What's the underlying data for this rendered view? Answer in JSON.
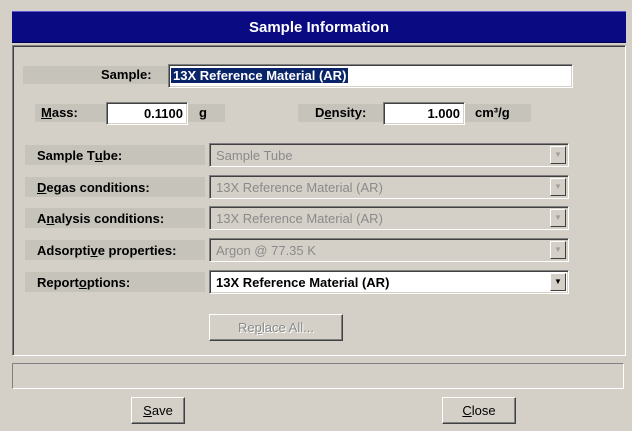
{
  "window": {
    "title": "Sample Information"
  },
  "sample": {
    "label": "Sample:",
    "value": "13X Reference Material (AR)"
  },
  "mass": {
    "label_pre": "",
    "label_key": "M",
    "label_post": "ass:",
    "value": "0.1100",
    "unit": "g"
  },
  "density": {
    "label_pre": "D",
    "label_key": "e",
    "label_post": "nsity:",
    "value": "1.000",
    "unit": "cm³/g"
  },
  "rows": [
    {
      "label_pre": "Sample T",
      "label_key": "u",
      "label_post": "be:",
      "value": "Sample Tube",
      "enabled": false
    },
    {
      "label_pre": "",
      "label_key": "D",
      "label_post": "egas conditions:",
      "value": "13X Reference Material (AR)",
      "enabled": false
    },
    {
      "label_pre": "A",
      "label_key": "n",
      "label_post": "alysis conditions:",
      "value": "13X Reference Material (AR)",
      "enabled": false
    },
    {
      "label_pre": "Adsorpti",
      "label_key": "v",
      "label_post": "e properties:",
      "value": "Argon @ 77.35 K",
      "enabled": false
    },
    {
      "label_pre": "Report ",
      "label_key": "o",
      "label_post": "ptions:",
      "value": "13X Reference Material (AR)",
      "enabled": true
    }
  ],
  "replace_all": {
    "label_pre": "Re",
    "label_key": "p",
    "label_post": "lace All..."
  },
  "status": {
    "text": ""
  },
  "buttons": {
    "save": {
      "label_pre": "",
      "label_key": "S",
      "label_post": "ave"
    },
    "close": {
      "label_pre": "",
      "label_key": "C",
      "label_post": "lose"
    }
  },
  "icons": {
    "dropdown": "chevron-down-icon"
  }
}
